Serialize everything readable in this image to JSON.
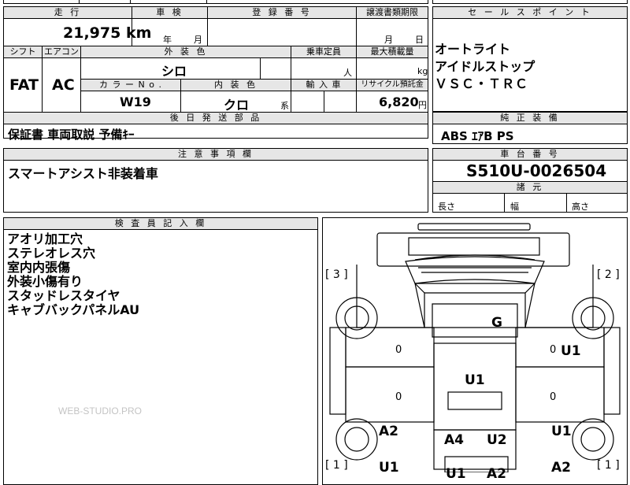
{
  "top_cut_text": "四 / 号 ん",
  "vehicle": {
    "mileage_label": "走 行",
    "mileage_value": "21,975",
    "mileage_unit": "km",
    "inspection_label": "車 検",
    "inspection_year": "年",
    "inspection_month": "月",
    "registration_label": "登 録 番 号",
    "transfer_label": "譲渡書類期限",
    "transfer_month": "月",
    "transfer_day": "日"
  },
  "specs": {
    "shift_label": "シフト",
    "aircon_label": "エアコン",
    "exterior_label": "外 装 色",
    "capacity_label": "乗車定員",
    "max_load_label": "最大積載量",
    "shift_value": "FAT",
    "aircon_value": "AC",
    "exterior_value": "シロ",
    "capacity_unit": "人",
    "max_load_unit": "kg",
    "color_no_label": "カ ラ ー N o .",
    "interior_label": "内 装 色",
    "import_label": "輸 入 車",
    "recycle_label": "リサイクル預託金",
    "color_no_value": "W19",
    "interior_value": "クロ",
    "interior_suffix": "系",
    "recycle_value": "6,820",
    "recycle_unit": "円"
  },
  "later_parts": {
    "label": "後 日 発 送 部 品",
    "value": "保証書 車両取説 予備ｷｰ"
  },
  "notes": {
    "label": "注 意 事 項 欄",
    "value": "スマートアシスト非装着車"
  },
  "sales_points": {
    "label": "セ ー ル ス ポ イ ン ト",
    "items": [
      "オートライト",
      "アイドルストップ",
      "ＶＳＣ・ＴＲＣ"
    ]
  },
  "genuine": {
    "label": "純 正 装 備",
    "value": "ABS ｴｱB PS"
  },
  "chassis": {
    "label": "車 台 番 号",
    "value": "S510U-0026504"
  },
  "dimensions": {
    "label": "諸 元",
    "length": "長さ",
    "width": "幅",
    "height": "高さ"
  },
  "inspector": {
    "label": "検 査 員 記 入 欄",
    "items": [
      "アオリ加工穴",
      "ステレオレス穴",
      "室内内張傷",
      "外装小傷有り",
      "スタッドレスタイヤ",
      "キャブバックパネルAU"
    ]
  },
  "watermark": "WEB-STUDIO.PRO",
  "diagram": {
    "tire_labels": [
      "[ 3 ]",
      "[ 2 ]",
      "[ 1 ]",
      "[ 1 ]"
    ],
    "codes": {
      "g": "G",
      "u1_center": "U1",
      "u1_right_upper": "U1",
      "u1_right_lower": "U1",
      "a2_left": "A2",
      "a4": "A4",
      "u2": "U2",
      "u1_bottom_left": "U1",
      "a2_bottom_right": "A2",
      "u1_bottom_center": "U1",
      "a2_bottom_center": "A2"
    },
    "zeros": [
      "0",
      "0",
      "0",
      "0"
    ]
  }
}
